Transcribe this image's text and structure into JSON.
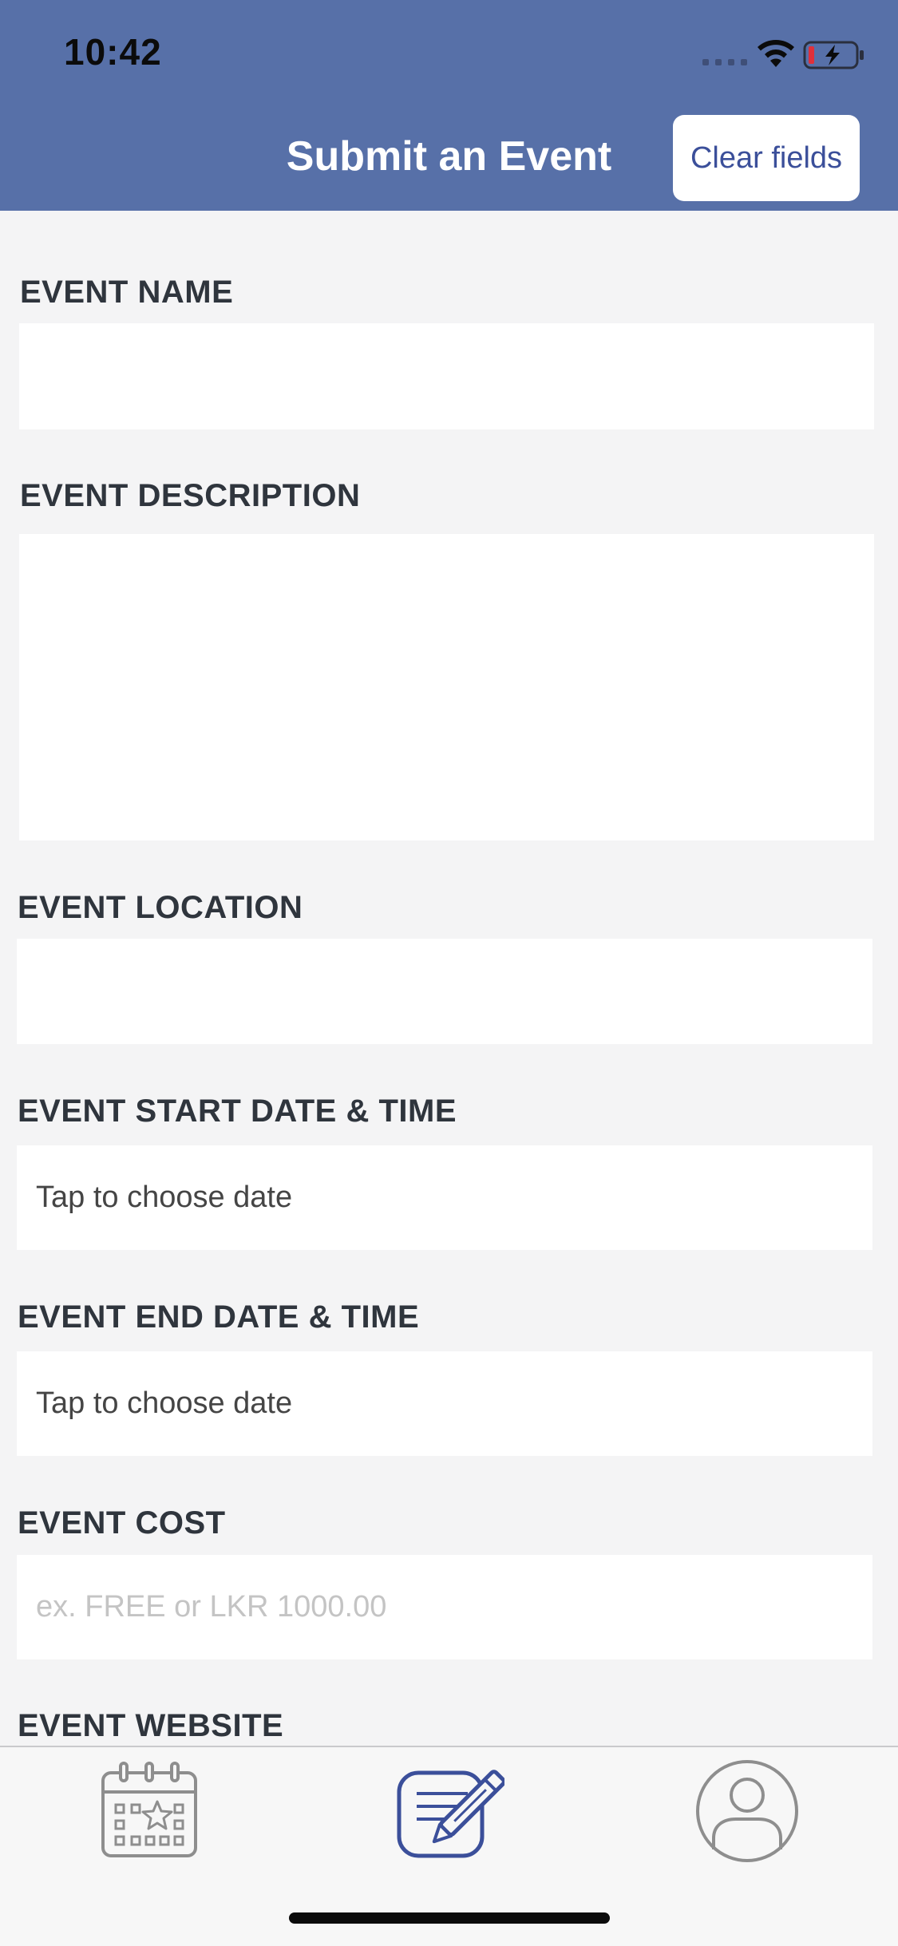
{
  "status_bar": {
    "time": "10:42"
  },
  "header": {
    "title": "Submit an Event",
    "clear_button_label": "Clear fields",
    "background_color": "#5770a8"
  },
  "form": {
    "event_name": {
      "label": "EVENT NAME",
      "value": ""
    },
    "event_description": {
      "label": "EVENT DESCRIPTION",
      "value": ""
    },
    "event_location": {
      "label": "EVENT LOCATION",
      "value": ""
    },
    "event_start": {
      "label": "EVENT START DATE & TIME",
      "value": "Tap to choose date"
    },
    "event_end": {
      "label": "EVENT END DATE & TIME",
      "value": "Tap to choose date"
    },
    "event_cost": {
      "label": "EVENT COST",
      "placeholder": "ex. FREE or LKR 1000.00"
    },
    "event_website": {
      "label": "EVENT WEBSITE"
    }
  },
  "tabbar": {
    "tabs": [
      {
        "icon": "calendar-star-icon",
        "active": false
      },
      {
        "icon": "edit-note-icon",
        "active": true
      },
      {
        "icon": "profile-icon",
        "active": false
      }
    ],
    "active_color": "#3b4f9a",
    "inactive_color": "#8e8e8e"
  }
}
